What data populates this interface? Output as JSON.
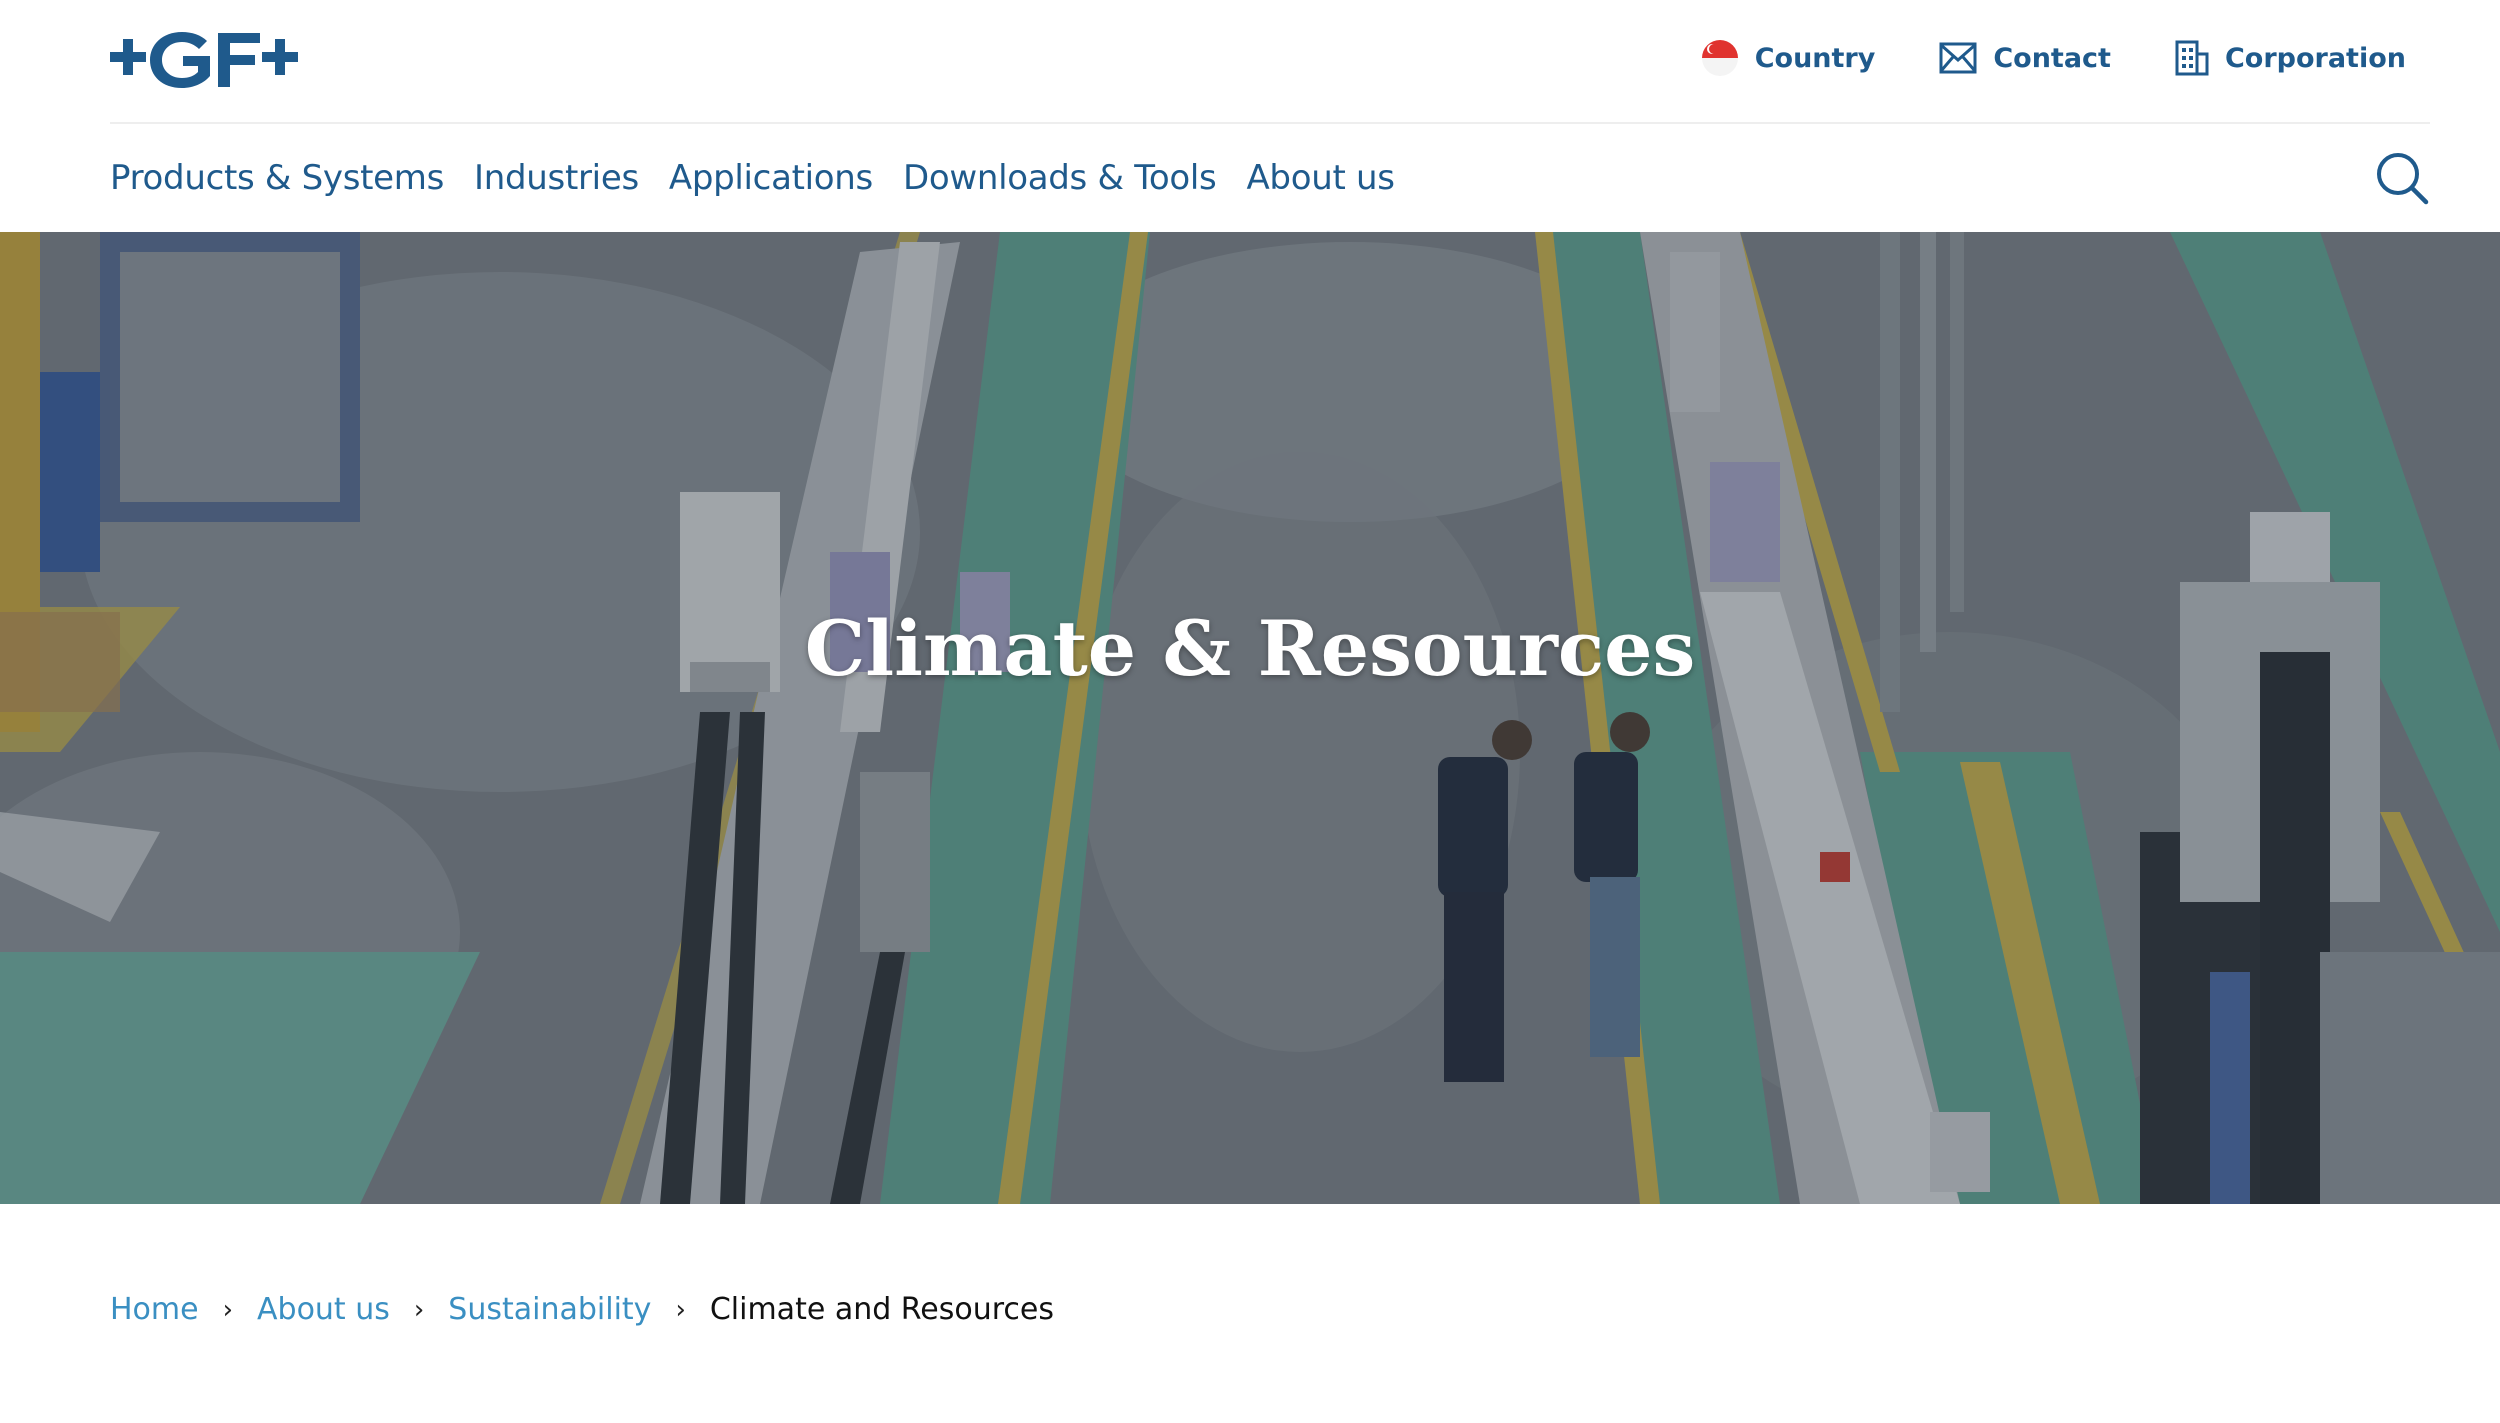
{
  "brand": {
    "logo_text": "+GF+",
    "primary_color": "#1f5a8c",
    "link_color": "#3a8fc2"
  },
  "top_links": [
    {
      "label": "Country",
      "icon": "singapore-flag-icon"
    },
    {
      "label": "Contact",
      "icon": "envelope-icon"
    },
    {
      "label": "Corporation",
      "icon": "building-icon"
    }
  ],
  "nav": {
    "items": [
      "Products & Systems",
      "Industries",
      "Applications",
      "Downloads & Tools",
      "About us"
    ],
    "search_icon": "search-icon"
  },
  "hero": {
    "title": "Climate & Resources"
  },
  "breadcrumb": {
    "home": "Home",
    "about": "About us",
    "sustainability": "Sustainability",
    "separator": "›",
    "current": "Climate and Resources"
  }
}
